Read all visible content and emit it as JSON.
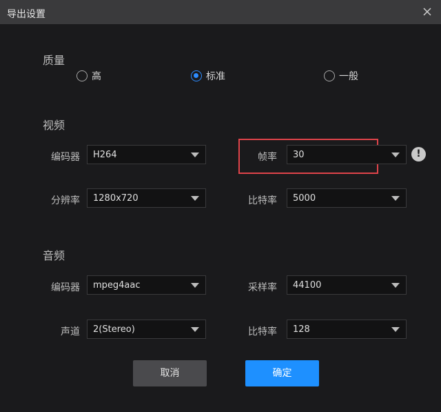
{
  "window": {
    "title": "导出设置",
    "close_icon": "close-icon"
  },
  "quality": {
    "section": "质量",
    "options": [
      {
        "label": "高",
        "checked": false
      },
      {
        "label": "标准",
        "checked": true
      },
      {
        "label": "一般",
        "checked": false
      }
    ]
  },
  "video": {
    "section": "视频",
    "encoder": {
      "label": "编码器",
      "value": "H264"
    },
    "framerate": {
      "label": "帧率",
      "value": "30"
    },
    "resolution": {
      "label": "分辨率",
      "value": "1280x720"
    },
    "bitrate": {
      "label": "比特率",
      "value": "5000"
    },
    "info_icon": "!"
  },
  "audio": {
    "section": "音频",
    "encoder": {
      "label": "编码器",
      "value": "mpeg4aac"
    },
    "samplerate": {
      "label": "采样率",
      "value": "44100"
    },
    "channel": {
      "label": "声道",
      "value": "2(Stereo)"
    },
    "bitrate": {
      "label": "比特率",
      "value": "128"
    }
  },
  "buttons": {
    "cancel": "取消",
    "ok": "确定"
  },
  "colors": {
    "accent": "#1e90ff",
    "highlight": "#e0444a",
    "bg": "#1a1a1c",
    "titlebar": "#3a3a3c"
  }
}
